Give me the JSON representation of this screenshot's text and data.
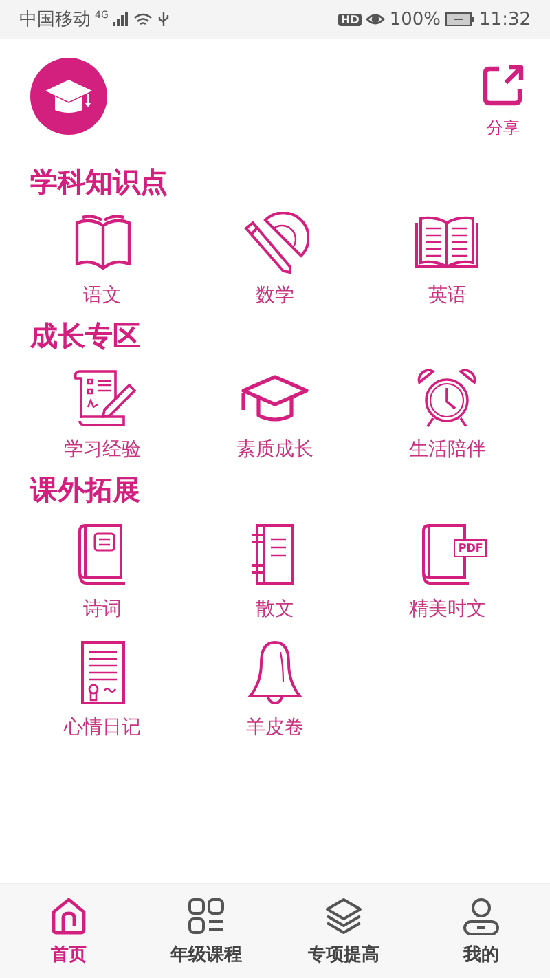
{
  "status_bar": {
    "carrier": "中国移动",
    "network": "4G",
    "hd": "HD",
    "battery": "100%",
    "time": "11:32"
  },
  "header": {
    "share_label": "分享"
  },
  "sections": [
    {
      "title": "学科知识点",
      "items": [
        {
          "label": "语文"
        },
        {
          "label": "数学"
        },
        {
          "label": "英语"
        }
      ]
    },
    {
      "title": "成长专区",
      "items": [
        {
          "label": "学习经验"
        },
        {
          "label": "素质成长"
        },
        {
          "label": "生活陪伴"
        }
      ]
    },
    {
      "title": "课外拓展",
      "items": [
        {
          "label": "诗词"
        },
        {
          "label": "散文"
        },
        {
          "label": "精美时文",
          "tag": "PDF"
        },
        {
          "label": "心情日记"
        },
        {
          "label": "羊皮卷"
        }
      ]
    }
  ],
  "tabs": [
    {
      "label": "首页",
      "selected": true
    },
    {
      "label": "年级课程",
      "selected": false
    },
    {
      "label": "专项提高",
      "selected": false
    },
    {
      "label": "我的",
      "selected": false
    }
  ]
}
